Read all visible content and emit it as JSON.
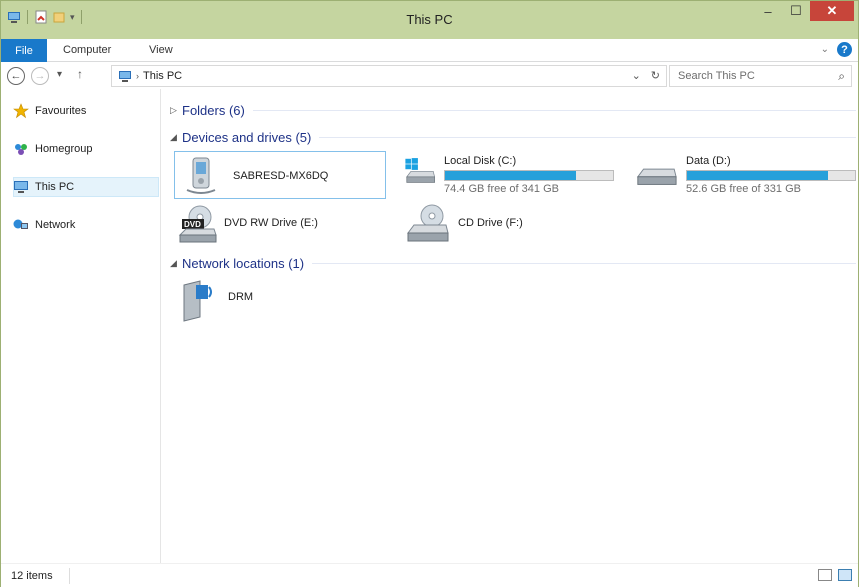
{
  "window": {
    "title": "This PC"
  },
  "ribbon": {
    "file": "File",
    "computer": "Computer",
    "view": "View"
  },
  "nav": {
    "breadcrumb": "This PC",
    "search_placeholder": "Search This PC"
  },
  "sidebar": {
    "items": [
      {
        "label": "Favourites",
        "icon": "star-icon"
      },
      {
        "label": "Homegroup",
        "icon": "homegroup-icon"
      },
      {
        "label": "This PC",
        "icon": "computer-icon",
        "selected": true
      },
      {
        "label": "Network",
        "icon": "network-icon"
      }
    ]
  },
  "groups": {
    "folders": "Folders (6)",
    "devices": "Devices and drives (5)",
    "network": "Network locations (1)"
  },
  "devices": [
    {
      "name": "SABRESD-MX6DQ",
      "icon": "portable-device-icon"
    },
    {
      "name": "Local Disk (C:)",
      "free": "74.4 GB free of 341 GB",
      "used_fraction": 0.78,
      "icon": "windows-drive-icon"
    },
    {
      "name": "Data (D:)",
      "free": "52.6 GB free of 331 GB",
      "used_fraction": 0.84,
      "icon": "hard-drive-icon"
    },
    {
      "name": "DVD RW Drive (E:)",
      "icon": "dvd-drive-icon"
    },
    {
      "name": "CD Drive (F:)",
      "icon": "cd-drive-icon"
    }
  ],
  "network_locations": [
    {
      "name": "DRM",
      "icon": "network-location-icon"
    }
  ],
  "status": {
    "count": "12 items"
  },
  "colors": {
    "accent": "#1979ca",
    "titlebar": "#c5d5a0",
    "drive_bar": "#26a0da",
    "close": "#c7453a"
  }
}
